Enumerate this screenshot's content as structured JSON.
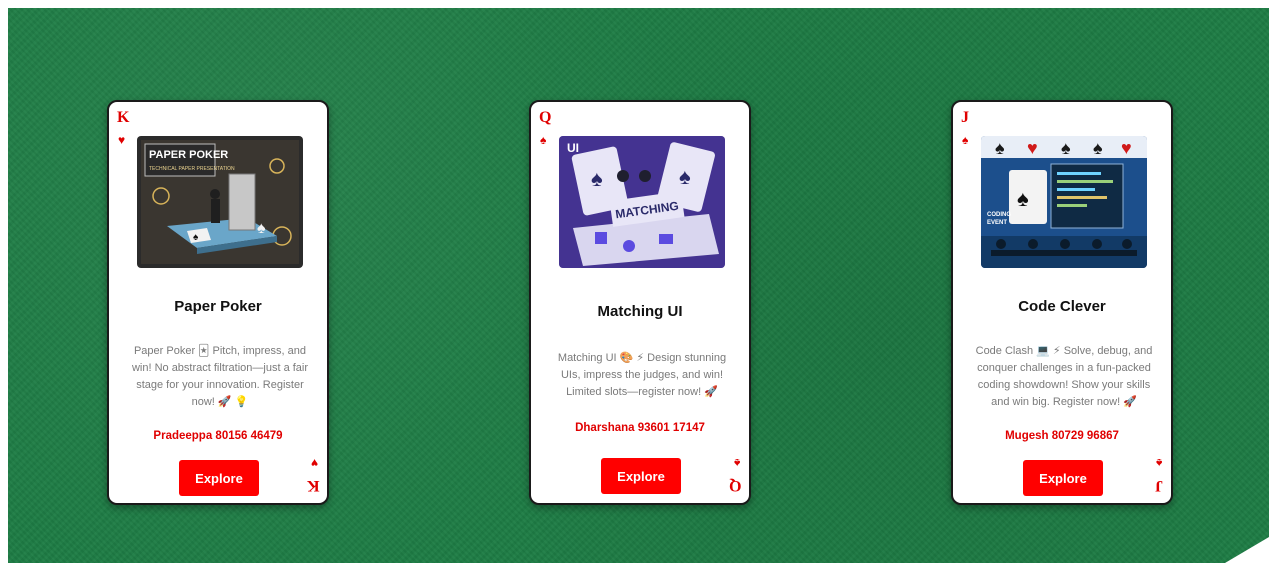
{
  "cards": [
    {
      "rank": "K",
      "suit": "♥",
      "title": "Paper Poker",
      "description": "Paper Poker 🃏 Pitch, impress, and win! No abstract filtration—just a fair stage for your innovation. Register now! 🚀 💡",
      "contact": "Pradeeppa 80156 46479",
      "button": "Explore",
      "image_text": [
        "PAPER POKER",
        "TECHNICAL PAPER PRESENTATION"
      ]
    },
    {
      "rank": "Q",
      "suit": "♠",
      "title": "Matching UI",
      "description": "Matching UI 🎨 ⚡ Design stunning UIs, impress the judges, and win! Limited slots—register now! 🚀",
      "contact": "Dharshana 93601 17147",
      "button": "Explore",
      "image_text": [
        "MATCHING",
        "UI"
      ]
    },
    {
      "rank": "J",
      "suit": "♠",
      "title": "Code Clever",
      "description": "Code Clash 💻 ⚡ Solve, debug, and conquer challenges in a fun-packed coding showdown! Show your skills and win big. Register now! 🚀",
      "contact": "Mugesh 80729 96867",
      "button": "Explore",
      "image_text": [
        "CODING",
        "EVENT"
      ]
    }
  ],
  "colors": {
    "felt": "#1e7d45",
    "accent": "#e00000",
    "button": "#ff0000"
  }
}
